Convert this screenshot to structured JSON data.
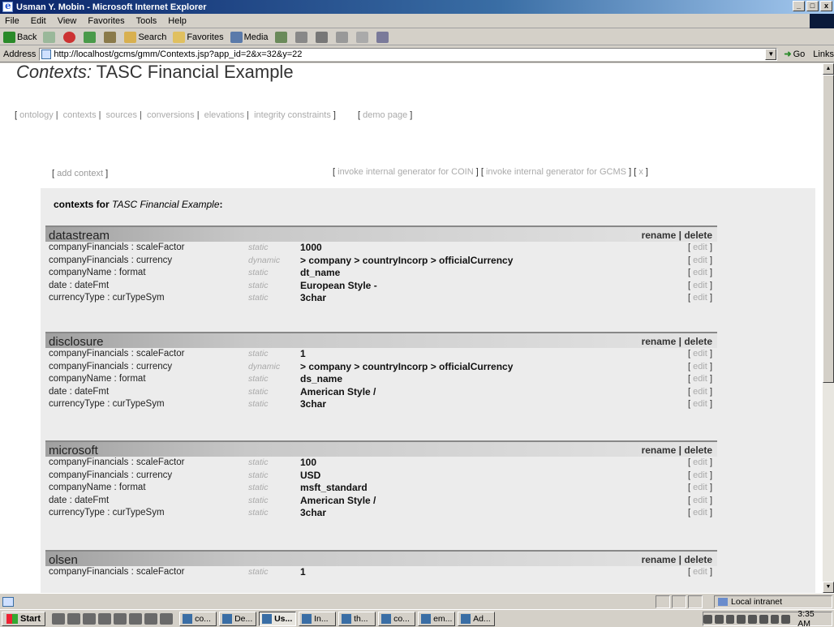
{
  "window": {
    "title": "Usman Y. Mobin - Microsoft Internet Explorer",
    "min": "_",
    "max": "□",
    "close": "x"
  },
  "menu": [
    "File",
    "Edit",
    "View",
    "Favorites",
    "Tools",
    "Help"
  ],
  "toolbar": {
    "back": "Back",
    "search": "Search",
    "favorites": "Favorites",
    "media": "Media"
  },
  "address": {
    "label": "Address",
    "url": "http://localhost/gcms/gmm/Contexts.jsp?app_id=2&x=32&y=22",
    "go": "Go",
    "links": "Links"
  },
  "page": {
    "heading_italic": "Contexts:",
    "heading_rest": " TASC Financial Example",
    "nav": [
      "ontology",
      "contexts",
      "sources",
      "conversions",
      "elevations",
      "integrity constraints"
    ],
    "demo": "demo page",
    "add_context": "add context",
    "gen_coin": "invoke internal generator for COIN",
    "gen_gcms": "invoke internal generator for GCMS",
    "gen_x": "x",
    "contexts_for": "contexts for",
    "app_name": "TASC Financial Example",
    "rename": "rename",
    "delete": "delete",
    "edit": "edit"
  },
  "contexts": [
    {
      "name": "datastream",
      "rows": [
        {
          "field": "companyFinancials : scaleFactor",
          "kind": "static",
          "value": "1000"
        },
        {
          "field": "companyFinancials : currency",
          "kind": "dynamic",
          "value": "> company > countryIncorp > officialCurrency"
        },
        {
          "field": "companyName : format",
          "kind": "static",
          "value": "dt_name"
        },
        {
          "field": "date : dateFmt",
          "kind": "static",
          "value": "European Style -"
        },
        {
          "field": "currencyType : curTypeSym",
          "kind": "static",
          "value": "3char"
        }
      ]
    },
    {
      "name": "disclosure",
      "rows": [
        {
          "field": "companyFinancials : scaleFactor",
          "kind": "static",
          "value": "1"
        },
        {
          "field": "companyFinancials : currency",
          "kind": "dynamic",
          "value": "> company > countryIncorp > officialCurrency"
        },
        {
          "field": "companyName : format",
          "kind": "static",
          "value": "ds_name"
        },
        {
          "field": "date : dateFmt",
          "kind": "static",
          "value": "American Style /"
        },
        {
          "field": "currencyType : curTypeSym",
          "kind": "static",
          "value": "3char"
        }
      ]
    },
    {
      "name": "microsoft",
      "rows": [
        {
          "field": "companyFinancials : scaleFactor",
          "kind": "static",
          "value": "100"
        },
        {
          "field": "companyFinancials : currency",
          "kind": "static",
          "value": "USD"
        },
        {
          "field": "companyName : format",
          "kind": "static",
          "value": "msft_standard"
        },
        {
          "field": "date : dateFmt",
          "kind": "static",
          "value": "American Style /"
        },
        {
          "field": "currencyType : curTypeSym",
          "kind": "static",
          "value": "3char"
        }
      ]
    },
    {
      "name": "olsen",
      "rows": [
        {
          "field": "companyFinancials : scaleFactor",
          "kind": "static",
          "value": "1"
        }
      ]
    }
  ],
  "status": {
    "zone": "Local intranet"
  },
  "taskbar": {
    "start": "Start",
    "tasks": [
      "co...",
      "De...",
      "Us...",
      "In...",
      "th...",
      "co...",
      "em...",
      "Ad..."
    ],
    "clock": "3:35 AM"
  }
}
